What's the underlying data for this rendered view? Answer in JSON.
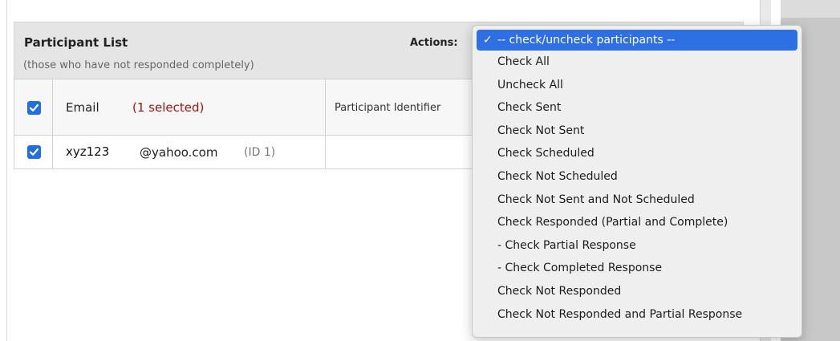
{
  "panel": {
    "title": "Participant List",
    "subtitle": "(those who have not responded completely)",
    "actions_label": "Actions:"
  },
  "table": {
    "header": {
      "email_label": "Email",
      "selected_count": "(1 selected)",
      "identifier_label": "Participant Identifier",
      "checked": true
    },
    "rows": [
      {
        "email_user": "xyz123",
        "email_domain": "@yahoo.com",
        "id_label": "(ID 1)",
        "checked": true
      }
    ]
  },
  "dropdown": {
    "selected_check": "✓",
    "items": [
      "-- check/uncheck participants --",
      "Check All",
      "Uncheck All",
      "Check Sent",
      "Check Not Sent",
      "Check Scheduled",
      "Check Not Scheduled",
      "Check Not Sent and Not Scheduled",
      "Check Responded (Partial and Complete)",
      "- Check Partial Response",
      "- Check Completed Response",
      "Check Not Responded",
      "Check Not Responded and Partial Response"
    ]
  },
  "colors": {
    "accent": "#2f6fe4",
    "checkbox": "#1f6fe0",
    "selected_text": "#a31515"
  }
}
